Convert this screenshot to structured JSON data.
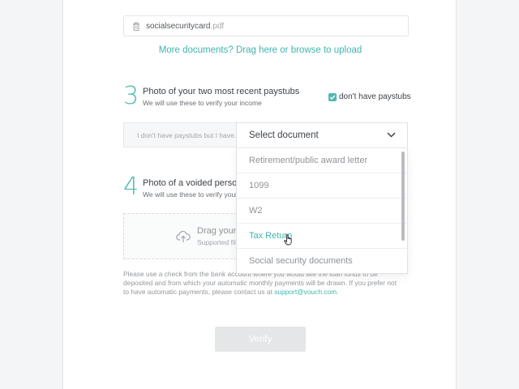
{
  "file": {
    "name_base": "socialsecuritycard",
    "name_ext": ".pdf",
    "icon": "trash-icon"
  },
  "upload": {
    "link_text": "More documents? Drag here or browse to upload"
  },
  "step3": {
    "number": "3",
    "title": "Photo of your two most recent paystubs",
    "subtitle": "We will use these to verify your income",
    "checkbox_label": "don't have paystubs",
    "checkbox_checked": true,
    "reason_text": "I don't have paystubs but I have...",
    "select_placeholder": "Select document",
    "options": [
      {
        "label": "Retirement/public award letter"
      },
      {
        "label": "1099"
      },
      {
        "label": "W2"
      },
      {
        "label": "Tax Return"
      },
      {
        "label": "Social security documents"
      }
    ],
    "hovered_option": "Tax Return"
  },
  "step4": {
    "number": "4",
    "title": "Photo of a voided person",
    "subtitle": "We will use these to verify your",
    "drop_title": "Drag your",
    "drop_sub": "Supported fil",
    "note_line1": "Please use a check from the bank account where you would like the loan funds to be",
    "note_line2": "deposited and from which your automatic monthly payments will be drawn. If you prefer not",
    "note_line3_pre": "to have automatic payments, please contact us at",
    "note_email": "support@vouch.com",
    "note_line3_post": "."
  },
  "verify": {
    "label": "Verify"
  },
  "colors": {
    "accent": "#4fbab1",
    "link": "#3fb5ac",
    "disabled_button": "#e4e6e8"
  }
}
